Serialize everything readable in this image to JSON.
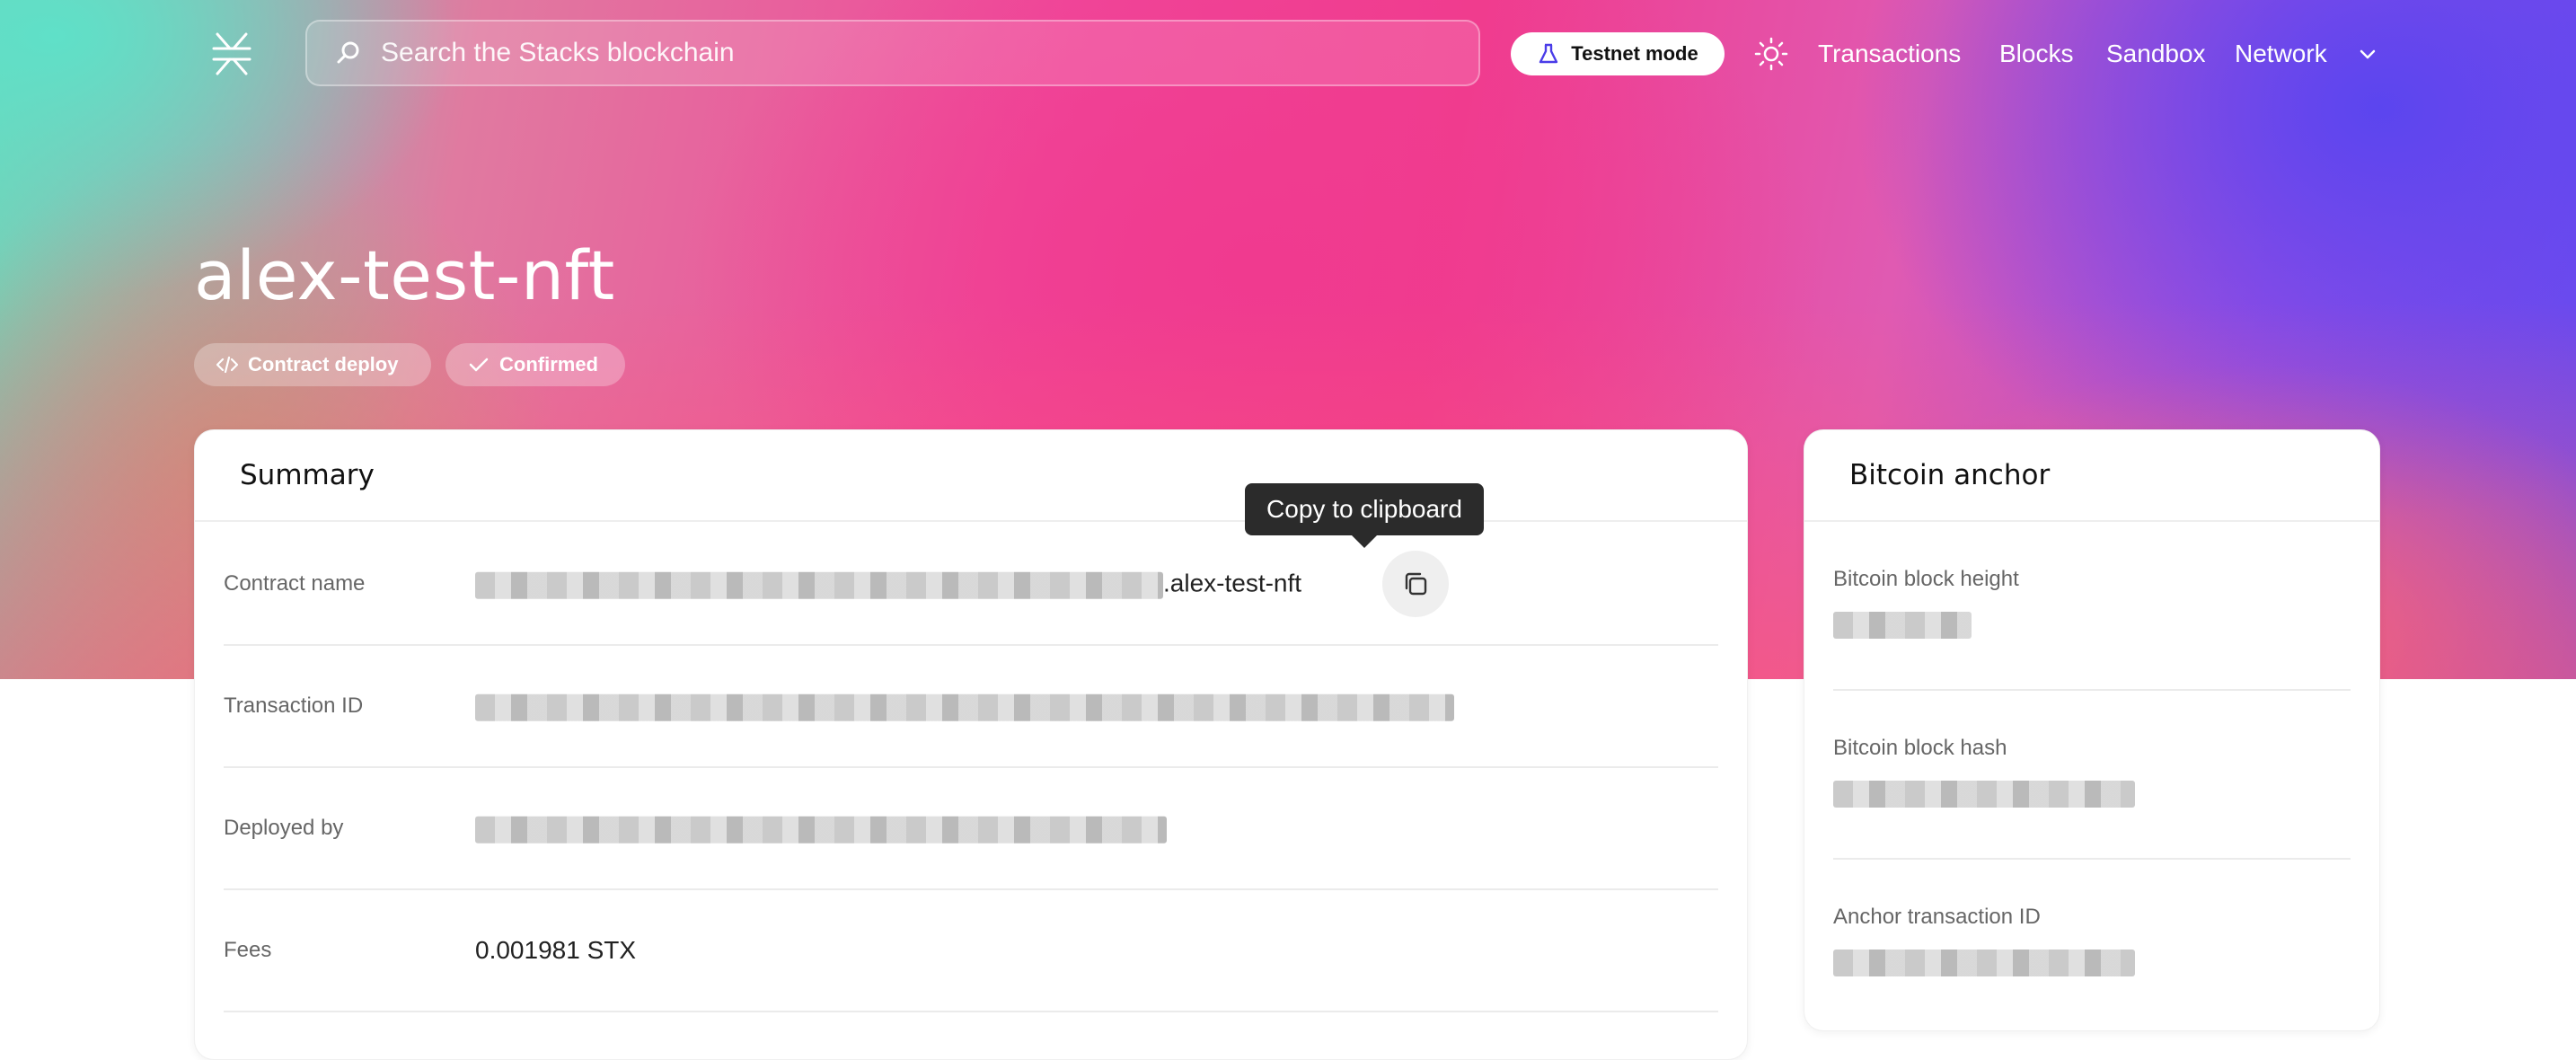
{
  "header": {
    "search_placeholder": "Search the Stacks blockchain",
    "testnet_label": "Testnet mode",
    "nav": [
      "Transactions",
      "Blocks",
      "Sandbox",
      "Network"
    ]
  },
  "page": {
    "title": "alex-test-nft",
    "badges": [
      "Contract deploy",
      "Confirmed"
    ]
  },
  "summary": {
    "title": "Summary",
    "rows": [
      {
        "label": "Contract name",
        "value_suffix": ".alex-test-nft"
      },
      {
        "label": "Transaction ID",
        "value": ""
      },
      {
        "label": "Deployed by",
        "value": ""
      },
      {
        "label": "Fees",
        "value": "0.001981 STX"
      }
    ],
    "tooltip": "Copy to clipboard"
  },
  "bitcoin_anchor": {
    "title": "Bitcoin anchor",
    "rows": [
      {
        "label": "Bitcoin block height"
      },
      {
        "label": "Bitcoin block hash"
      },
      {
        "label": "Anchor transaction ID"
      }
    ]
  },
  "colors": {
    "hero_pink": "#f03c8e",
    "hero_teal": "#5fe0c8",
    "hero_purple": "#5b45ef"
  },
  "icons": [
    "stacks-logo-icon",
    "search-icon",
    "flask-icon",
    "sun-icon",
    "chevron-down-icon",
    "code-icon",
    "check-icon",
    "copy-icon"
  ]
}
